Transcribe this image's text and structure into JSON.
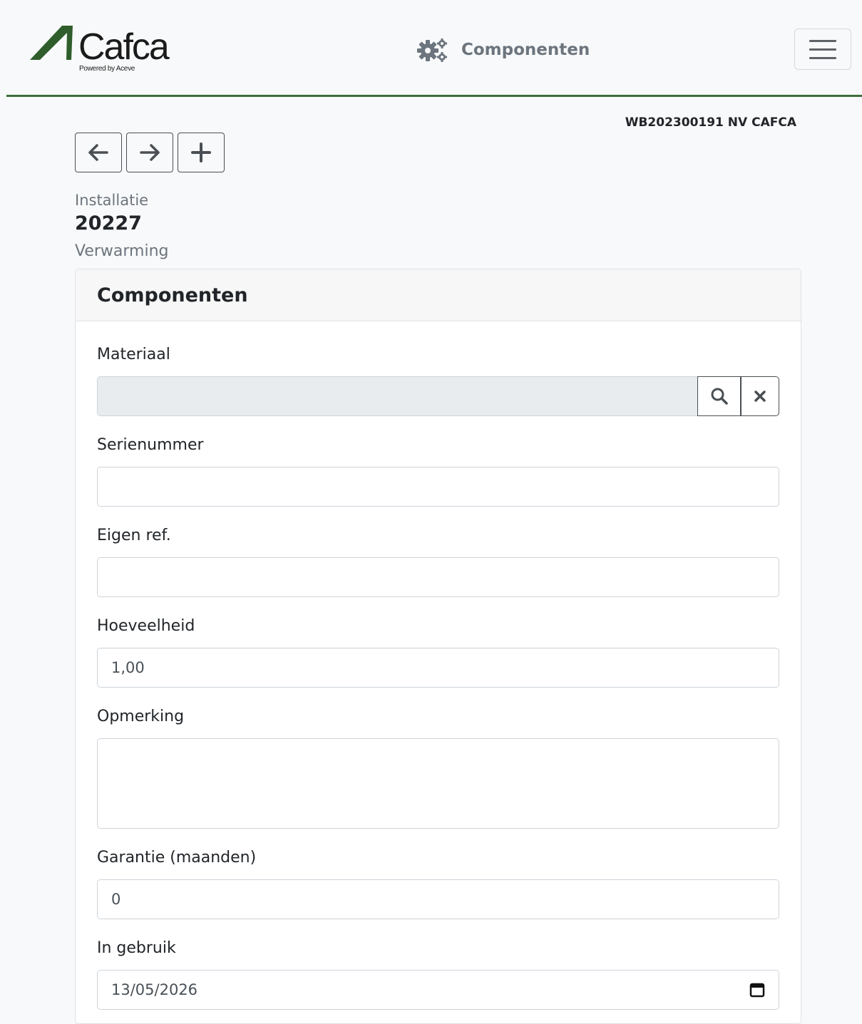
{
  "navbar": {
    "logo_text": "Cafca",
    "logo_subtext": "Powered by Aceve",
    "page_title": "Componenten",
    "title_icon": "gears-icon",
    "menu_icon": "hamburger-icon"
  },
  "header": {
    "document_ref": "WB202300191 NV CAFCA",
    "nav_buttons": [
      {
        "icon": "arrow-left-icon"
      },
      {
        "icon": "arrow-right-icon"
      },
      {
        "icon": "plus-icon"
      }
    ],
    "installatie_label": "Installatie",
    "installatie_value": "20227",
    "installatie_description": "Verwarming"
  },
  "card": {
    "title": "Componenten",
    "fields": {
      "materiaal": {
        "label": "Materiaal",
        "value": ""
      },
      "serienummer": {
        "label": "Serienummer",
        "value": ""
      },
      "eigen_ref": {
        "label": "Eigen ref.",
        "value": ""
      },
      "hoeveelheid": {
        "label": "Hoeveelheid",
        "value": "1,00"
      },
      "opmerking": {
        "label": "Opmerking",
        "value": ""
      },
      "garantie": {
        "label": "Garantie (maanden)",
        "value": "0"
      },
      "in_gebruik": {
        "label": "In gebruik",
        "value": "13/05/2026"
      }
    }
  },
  "colors": {
    "accent_border": "#3f6e3d",
    "logo_green": "#2f5e2c",
    "muted_text": "#6c757d"
  }
}
